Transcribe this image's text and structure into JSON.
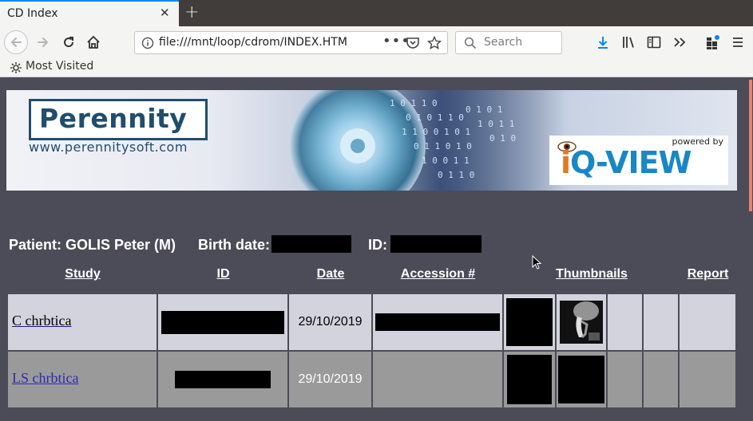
{
  "browser": {
    "tab_title": "CD Index",
    "url": "file:///mnt/loop/cdrom/INDEX.HTM",
    "search_placeholder": "Search",
    "bookmark_label": "Most Visited"
  },
  "banner": {
    "logo_name": "Perennity",
    "logo_url": "www.perennitysoft.com",
    "powered_by": "powered by",
    "iq_brand": "Q-VIEW",
    "iq_prefix": "i"
  },
  "patient": {
    "patient_label": "Patient: GOLIS Peter (M)",
    "birth_label": "Birth date:",
    "id_label": "ID:"
  },
  "table": {
    "headers": {
      "study": "Study",
      "id": "ID",
      "date": "Date",
      "accession": "Accession #",
      "thumbnails": "Thumbnails",
      "report": "Report"
    },
    "rows": [
      {
        "study": "C chrbtica",
        "date": "29/10/2019"
      },
      {
        "study": "LS chrbtica",
        "date": "29/10/2019"
      }
    ]
  },
  "icons": [
    "back-icon",
    "forward-icon",
    "reload-icon",
    "home-icon",
    "info-icon",
    "more-icon",
    "pocket-icon",
    "star-icon",
    "search-icon",
    "download-icon",
    "library-icon",
    "sidebar-icon",
    "overflow-icon",
    "extensions-icon",
    "menu-icon",
    "gear-icon",
    "close-icon",
    "plus-icon"
  ]
}
